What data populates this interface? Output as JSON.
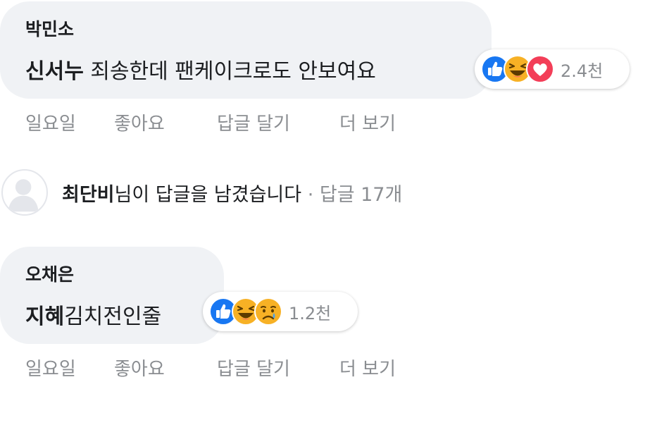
{
  "comments": [
    {
      "author": "박민소",
      "mention": "신서누",
      "text": " 죄송한데 팬케이크로도 안보여요",
      "reactions": [
        "like-icon",
        "haha-icon",
        "love-icon"
      ],
      "reaction_count": "2.4천",
      "actions": {
        "time": "일요일",
        "like": "좋아요",
        "reply": "답글 달기",
        "more": "더 보기"
      }
    },
    {
      "author": "오채은",
      "mention": "지혜",
      "text": "김치전인줄",
      "reactions": [
        "like-icon",
        "haha-icon",
        "sad-icon"
      ],
      "reaction_count": "1.2천",
      "actions": {
        "time": "일요일",
        "like": "좋아요",
        "reply": "답글 달기",
        "more": "더 보기"
      }
    }
  ],
  "reply_summary": {
    "name": "최단비",
    "text": "님이 답글을 남겼습니다",
    "separator": " · ",
    "count": "답글 17개"
  },
  "colors": {
    "bubble": "#f0f2f5",
    "like_blue": "#1877f2",
    "haha_yellow": "#f7b125",
    "love_red": "#f33e58",
    "meta_gray": "#8a8d91"
  }
}
